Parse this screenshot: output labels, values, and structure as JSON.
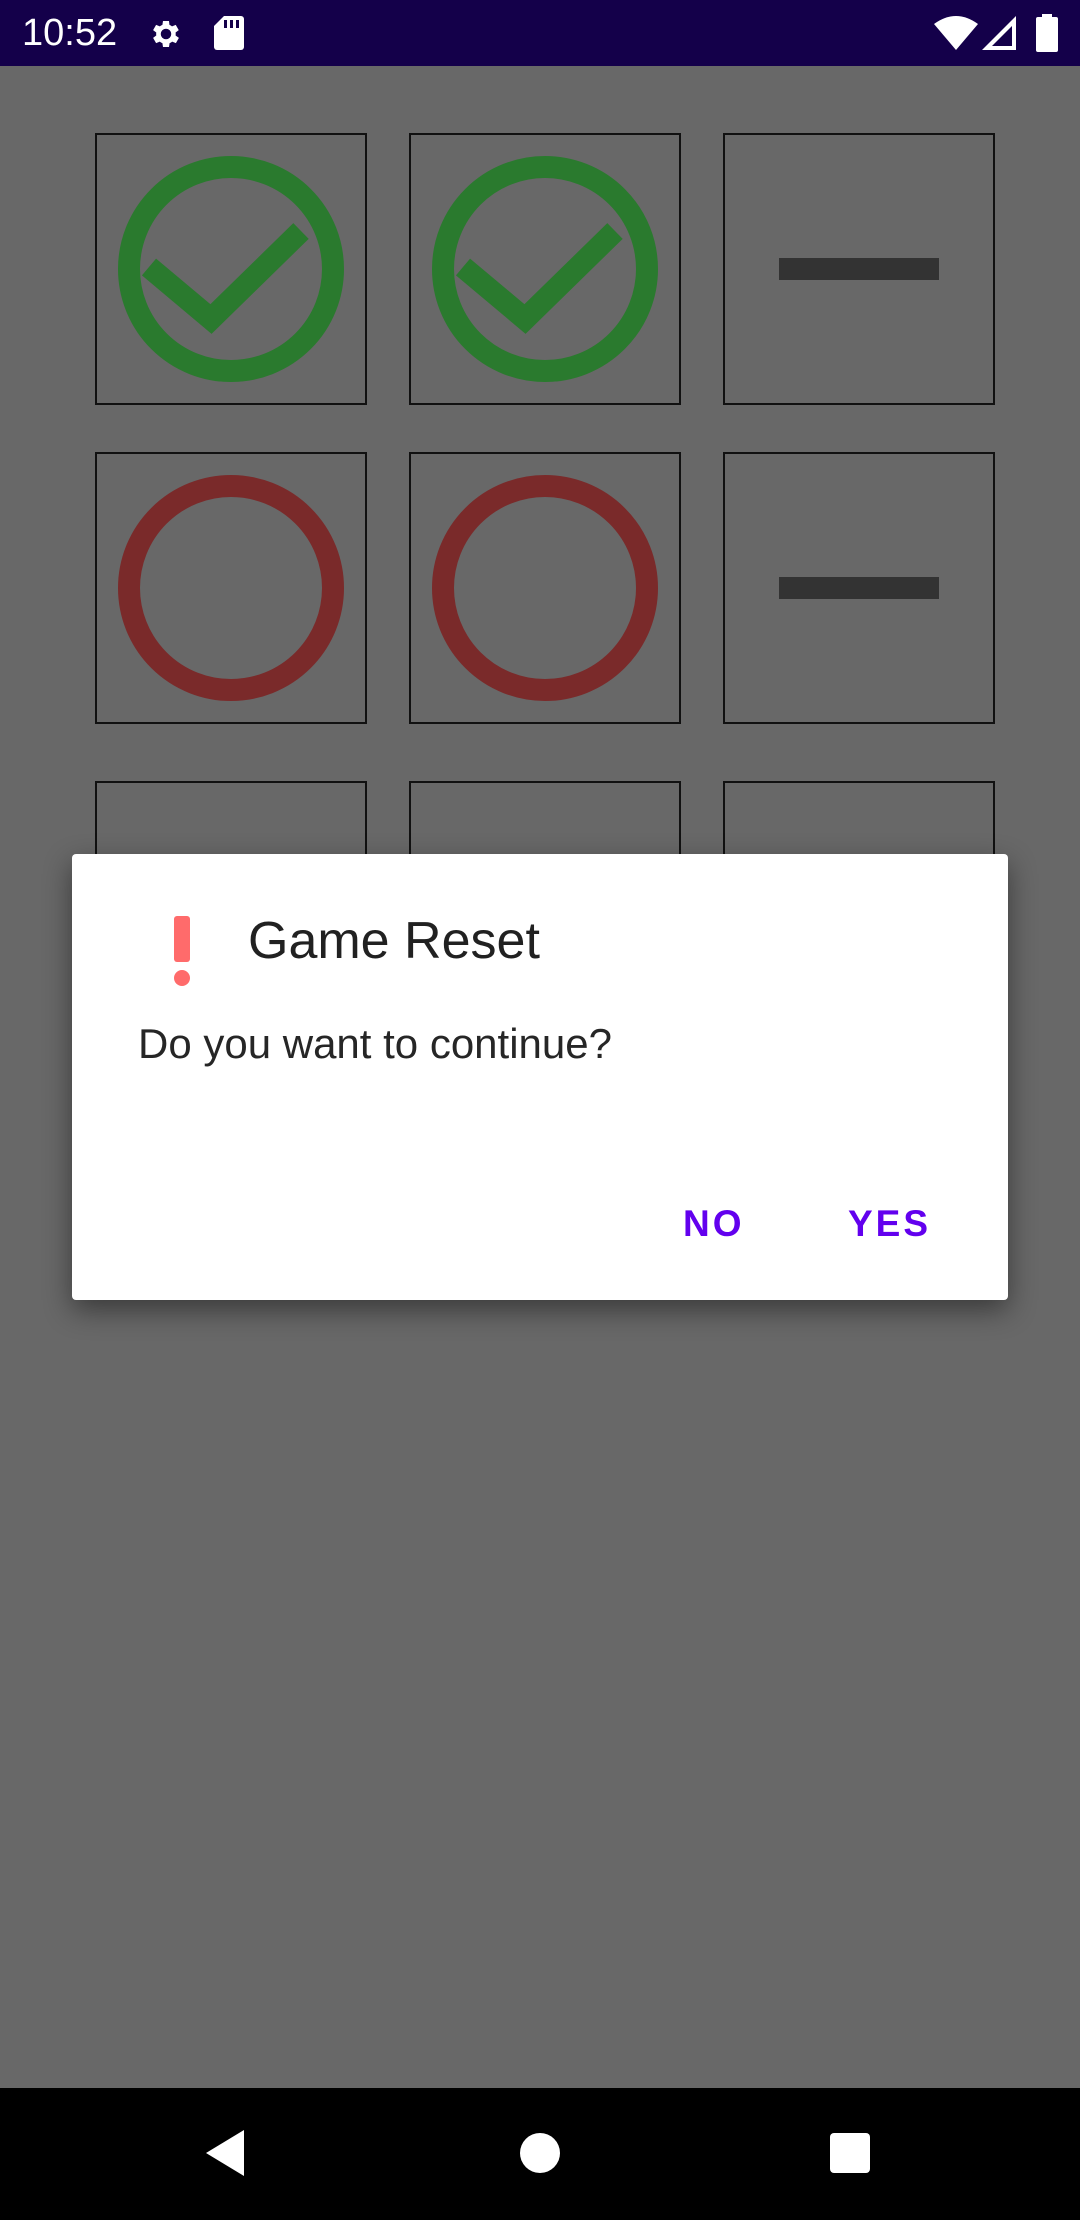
{
  "status_bar": {
    "time": "10:52",
    "left_icons": [
      "gear-icon",
      "sd-card-icon"
    ],
    "right_icons": [
      "wifi-icon",
      "signal-icon",
      "battery-icon"
    ]
  },
  "board": {
    "rows": [
      [
        "check",
        "check",
        "dash"
      ],
      [
        "circle",
        "circle",
        "dash"
      ],
      [
        "empty",
        "empty",
        "empty"
      ]
    ],
    "colors": {
      "check": "#2a7a2e",
      "circle": "#7a2a2a",
      "dash": "#333333",
      "cell_border": "#111111"
    }
  },
  "dialog": {
    "icon": "exclamation-icon",
    "icon_color": "#ff6b6b",
    "title": "Game Reset",
    "message": "Do you want to continue?",
    "buttons": {
      "negative": "NO",
      "positive": "YES"
    },
    "accent_color": "#6200ee"
  },
  "nav_bar": {
    "icons": [
      "back-icon",
      "home-icon",
      "recents-icon"
    ]
  }
}
